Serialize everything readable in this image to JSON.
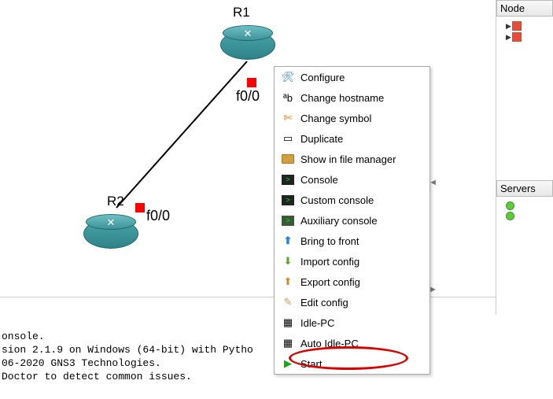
{
  "topology": {
    "routers": [
      {
        "label": "R1",
        "port": "f0/0"
      },
      {
        "label": "R2",
        "port": "f0/0"
      }
    ]
  },
  "context_menu": {
    "configure": "Configure",
    "change_hostname": "Change hostname",
    "change_symbol": "Change symbol",
    "duplicate": "Duplicate",
    "show_in_file_manager": "Show in file manager",
    "console": "Console",
    "custom_console": "Custom console",
    "auxiliary_console": "Auxiliary console",
    "bring_to_front": "Bring to front",
    "import_config": "Import config",
    "export_config": "Export config",
    "edit_config": "Edit config",
    "idle_pc": "Idle-PC",
    "auto_idle_pc": "Auto Idle-PC",
    "start": "Start"
  },
  "console_log": {
    "l1": "onsole.",
    "l2": "sion 2.1.9 on Windows (64-bit) with Pytho",
    "l3": "06-2020 GNS3 Technologies.",
    "l4": "Doctor to detect common issues."
  },
  "panels": {
    "node_title": "Node",
    "servers_title": "Servers"
  }
}
